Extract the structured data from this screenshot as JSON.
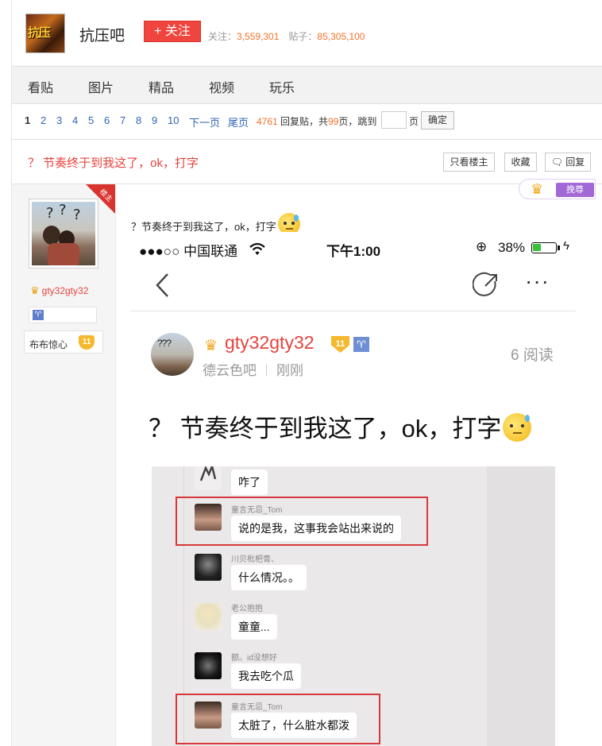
{
  "header": {
    "bar_name": "抗压吧",
    "logo_text": "抗压",
    "follow_label": "+ 关注",
    "followers_label": "关注：",
    "followers_value": "3,559,301",
    "posts_label": "贴子：",
    "posts_value": "85,305,100"
  },
  "nav": {
    "items": [
      "看贴",
      "图片",
      "精品",
      "视频",
      "玩乐"
    ]
  },
  "pager": {
    "current": "1",
    "pages": [
      "2",
      "3",
      "4",
      "5",
      "6",
      "7",
      "8",
      "9",
      "10"
    ],
    "next": "下一页",
    "last": "尾页",
    "reply_count": "4761",
    "reply_label": "回复贴，共",
    "page_count": "99",
    "page_label": "页，跳到",
    "unit": "页",
    "confirm": "确定"
  },
  "thread": {
    "title": "？ 节奏终于到我这了，ok，打字",
    "only_op": "只看楼主",
    "favorite": "收藏",
    "reply": "回复"
  },
  "author": {
    "ribbon": "楼主",
    "name": "gty32gty32",
    "zodiac": "♈",
    "level_name": "布布惊心",
    "level": "11"
  },
  "tip": {
    "label": "挽尊"
  },
  "post": {
    "text": "？节奏终于到我这了，ok，打字"
  },
  "screenshot": {
    "status": {
      "signal": "●●●○○ 中国联通",
      "wifi": "✓",
      "time": "下午1:00",
      "battery": "38%",
      "battery_level": 0.38
    },
    "author_name": "gty32gty32",
    "author_level": "11",
    "author_zodiac": "♈",
    "bar": "德云色吧",
    "time": "刚刚",
    "reads": "6 阅读",
    "title": "？ 节奏终于到我这了，ok，打字",
    "chat": [
      {
        "name": "",
        "text": "咋了"
      },
      {
        "name": "童言无忌_Tom",
        "text": "说的是我，这事我会站出来说的"
      },
      {
        "name": "川贝枇杷膏、",
        "text": "什么情况。。"
      },
      {
        "name": "老公抱抱",
        "text": "童童..."
      },
      {
        "name": "额。id没想好",
        "text": "我去吃个瓜"
      },
      {
        "name": "童言无忌_Tom",
        "text": "太脏了，什么脏水都泼"
      }
    ]
  },
  "colors": {
    "accent_red": "#e5433d",
    "link_blue": "#2d64b3",
    "orange": "#f5722a",
    "level_gold": "#f5b82e",
    "tip_purple": "#a168d6"
  },
  "icons": {
    "crown": "crown-icon",
    "zodiac": "aries-icon",
    "emoji": "sweat-emoji-icon",
    "back": "back-arrow-icon",
    "share": "share-icon",
    "more": "more-icon"
  }
}
